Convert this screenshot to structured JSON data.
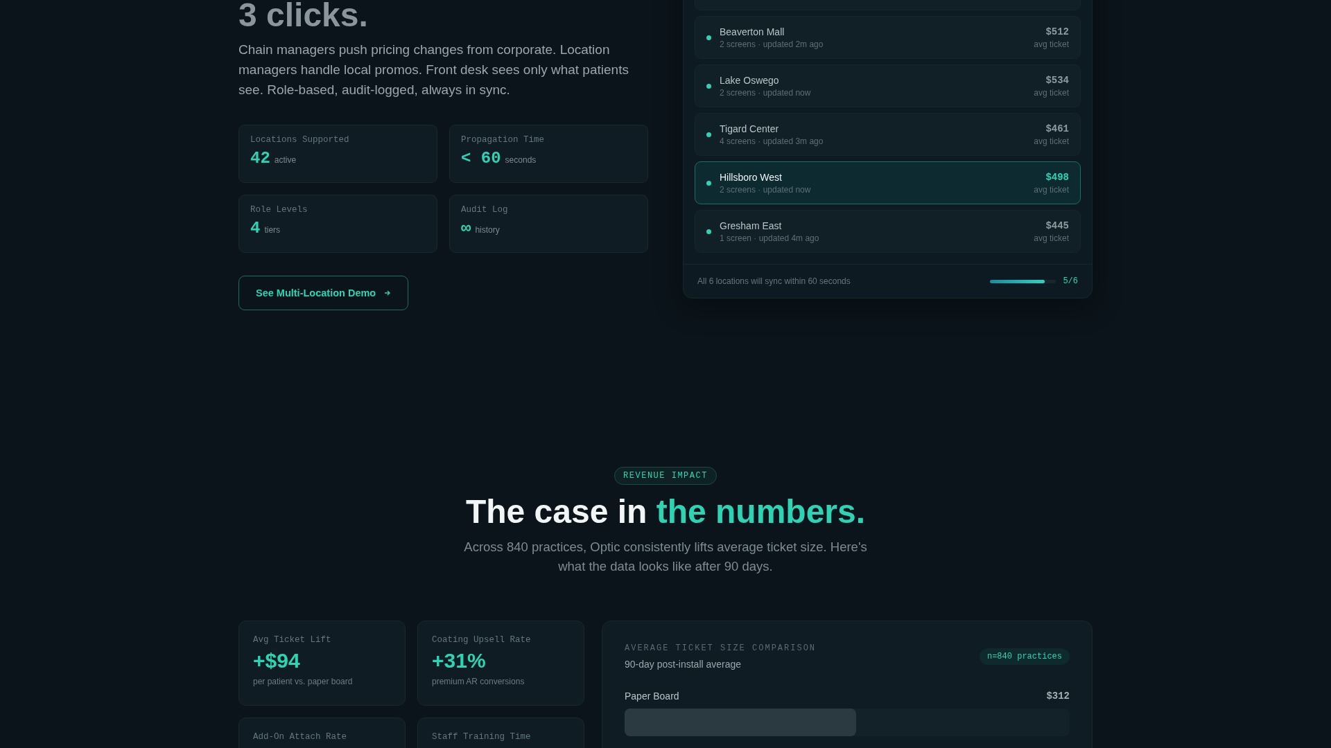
{
  "sync": {
    "heading": "3 clicks.",
    "description": "Chain managers push pricing changes from corporate. Location managers handle local promos. Front desk sees only what patients see. Role-based, audit-logged, always in sync.",
    "stats": [
      {
        "label": "Locations Supported",
        "value": "42",
        "unit": "active"
      },
      {
        "label": "Propagation Time",
        "value": "< 60",
        "unit": "seconds"
      },
      {
        "label": "Role Levels",
        "value": "4",
        "unit": "tiers"
      },
      {
        "label": "Audit Log",
        "value": "∞",
        "unit": "history"
      }
    ],
    "demo_button": "See Multi-Location Demo",
    "locations": [
      {
        "name": "Beaverton Mall",
        "detail": "2 screens · updated 2m ago",
        "price": "$512",
        "price_label": "avg ticket",
        "selected": false
      },
      {
        "name": "Lake Oswego",
        "detail": "2 screens · updated now",
        "price": "$534",
        "price_label": "avg ticket",
        "selected": false
      },
      {
        "name": "Tigard Center",
        "detail": "4 screens · updated 3m ago",
        "price": "$461",
        "price_label": "avg ticket",
        "selected": false
      },
      {
        "name": "Hillsboro West",
        "detail": "2 screens · updated now",
        "price": "$498",
        "price_label": "avg ticket",
        "selected": true
      },
      {
        "name": "Gresham East",
        "detail": "1 screen · updated 4m ago",
        "price": "$445",
        "price_label": "avg ticket",
        "selected": false
      }
    ],
    "footer": {
      "text": "All 6 locations will sync within 60 seconds",
      "level": 0.83,
      "reading": "5/6"
    }
  },
  "revenue": {
    "badge": "REVENUE IMPACT",
    "heading": "The case in",
    "heading_accent": "the numbers.",
    "description": "Across 840 practices, Optic consistently lifts average ticket size. Here's what the data looks like after 90 days.",
    "metrics": [
      {
        "label": "Avg Ticket Lift",
        "value": "+$94",
        "caption": "per patient vs. paper board"
      },
      {
        "label": "Coating Upsell Rate",
        "value": "+31%",
        "caption": "premium AR conversions"
      },
      {
        "label": "Add-On Attach Rate"
      },
      {
        "label": "Staff Training Time"
      }
    ],
    "comparison": {
      "title": "AVERAGE TICKET SIZE COMPARISON",
      "subtitle": "90-day post-install average",
      "badge": "n=840 practices",
      "rows": [
        {
          "label": "Paper Board",
          "value": "$312",
          "level": 0.52
        }
      ]
    }
  }
}
